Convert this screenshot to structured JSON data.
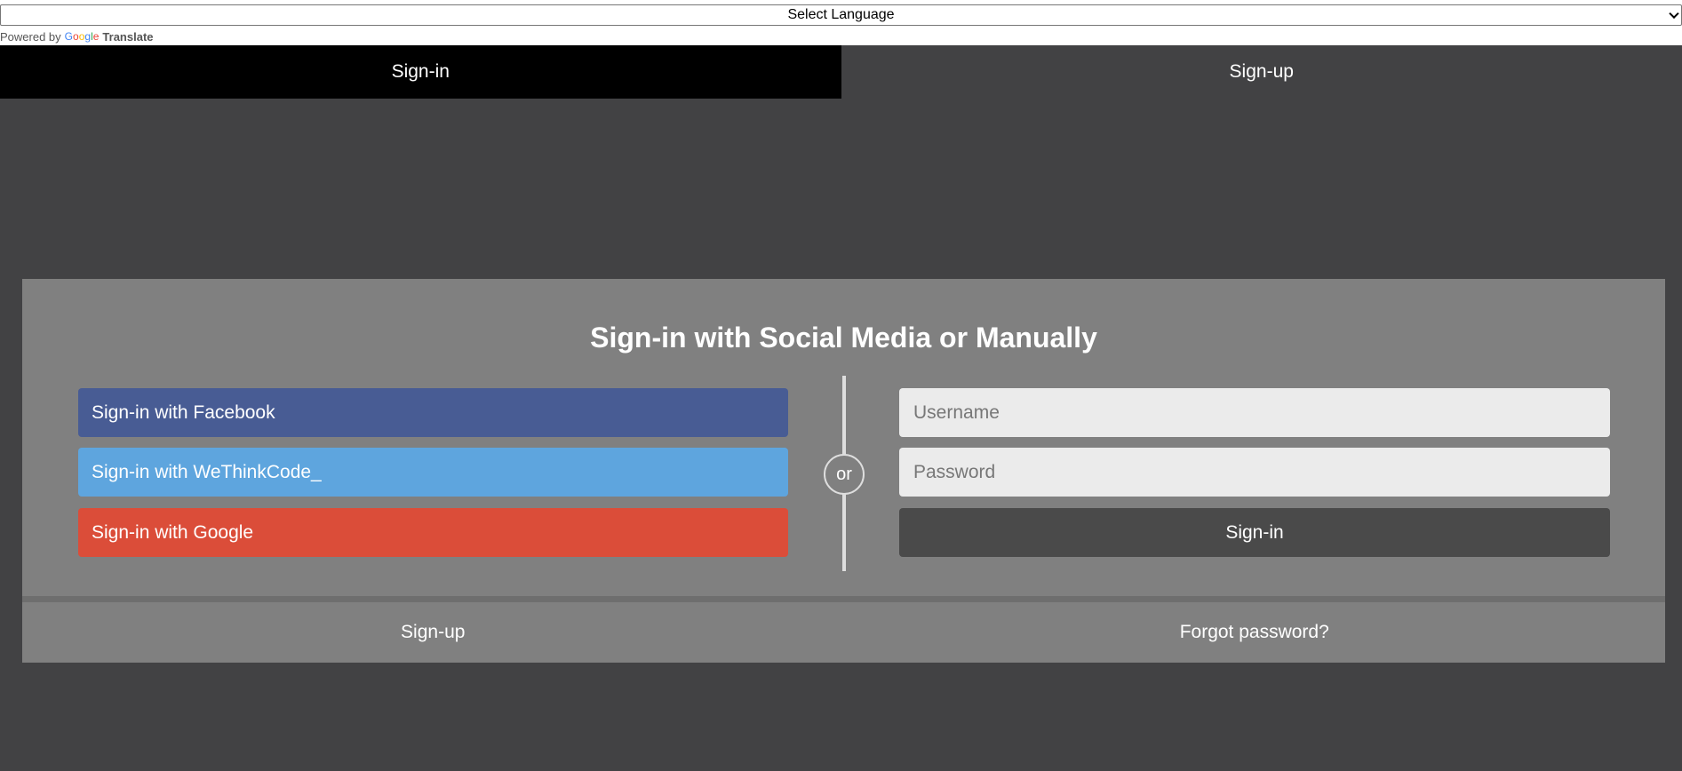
{
  "translate": {
    "select_label": "Select Language",
    "powered_by": "Powered by",
    "google_letters": [
      "G",
      "o",
      "o",
      "g",
      "l",
      "e"
    ],
    "translate_label": "Translate"
  },
  "tabs": [
    {
      "label": "Sign-in",
      "active": true
    },
    {
      "label": "Sign-up",
      "active": false
    }
  ],
  "card": {
    "title": "Sign-in with Social Media or Manually",
    "social": {
      "facebook": "Sign-in with Facebook",
      "wethinkcode": "Sign-in with WeThinkCode_",
      "google": "Sign-in with Google"
    },
    "divider_text": "or",
    "form": {
      "username_placeholder": "Username",
      "password_placeholder": "Password",
      "submit_label": "Sign-in"
    },
    "footer": {
      "signup_label": "Sign-up",
      "forgot_label": "Forgot password?"
    }
  },
  "colors": {
    "page_bg": "#424244",
    "card_bg": "#808080",
    "facebook": "#485c94",
    "wethinkcode": "#5ea5de",
    "google": "#db4d39",
    "submit": "#4a4a4a",
    "active_tab": "#000000"
  }
}
